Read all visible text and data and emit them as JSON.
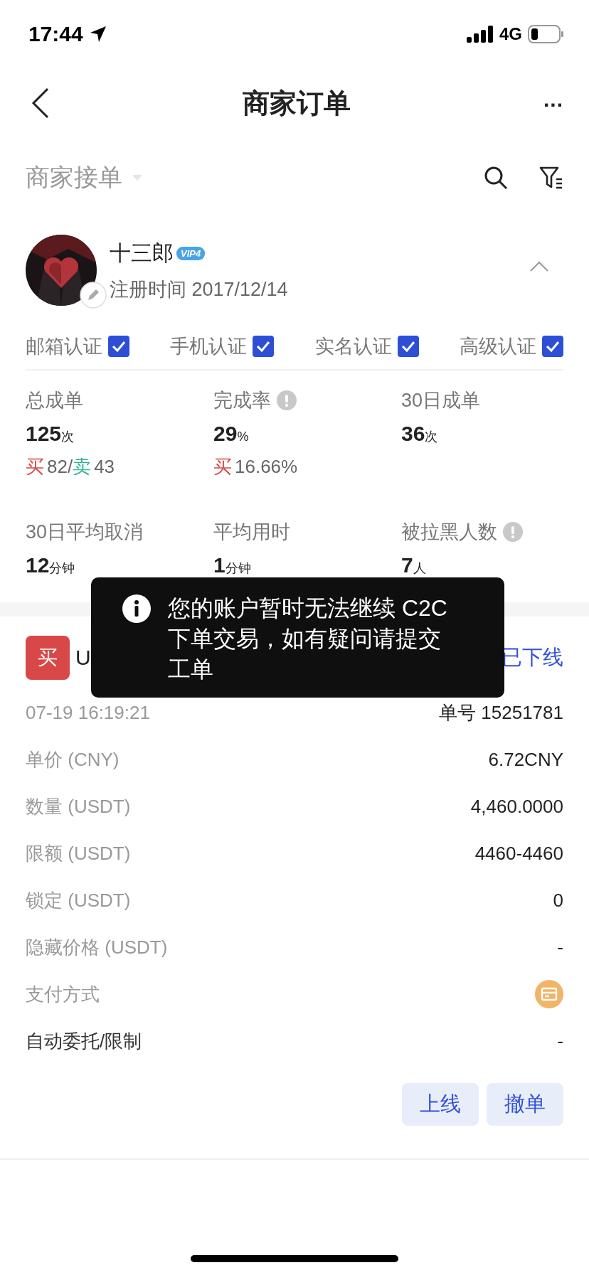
{
  "status_bar": {
    "time": "17:44",
    "network": "4G"
  },
  "nav": {
    "title": "商家订单",
    "more": "..."
  },
  "filter": {
    "label": "商家接单"
  },
  "merchant": {
    "name": "十三郎",
    "vip": "VIP4",
    "registered": "注册时间 2017/12/14",
    "expanded": true,
    "verifications": [
      {
        "label": "邮箱认证",
        "checked": true
      },
      {
        "label": "手机认证",
        "checked": true
      },
      {
        "label": "实名认证",
        "checked": true
      },
      {
        "label": "高级认证",
        "checked": true
      }
    ]
  },
  "stats": [
    {
      "label": "总成单",
      "info": false,
      "value": "125",
      "unit": "次",
      "breakdown": [
        {
          "kind": "buy",
          "text": "买"
        },
        {
          "kind": "plain",
          "text": "82/"
        },
        {
          "kind": "sell",
          "text": "卖"
        },
        {
          "kind": "plain",
          "text": "43"
        }
      ]
    },
    {
      "label": "完成率",
      "info": true,
      "value": "29",
      "unit": "%",
      "breakdown": [
        {
          "kind": "buy",
          "text": "买"
        },
        {
          "kind": "plain",
          "text": "16.66%"
        }
      ]
    },
    {
      "label": "30日成单",
      "info": false,
      "value": "36",
      "unit": "次"
    },
    {
      "label": "30日平均取消",
      "info": false,
      "value": "12",
      "unit": "分钟"
    },
    {
      "label": "平均用时",
      "info": false,
      "value": "1",
      "unit": "分钟"
    },
    {
      "label": "被拉黑人数",
      "info": true,
      "value": "7",
      "unit": "人"
    }
  ],
  "order": {
    "side": "买",
    "title": "U",
    "status": "已下线",
    "date": "07-19 16:19:21",
    "number": "单号 15251781",
    "fields": [
      {
        "kind": "plain",
        "label": "单价 (CNY)",
        "value": "6.72CNY"
      },
      {
        "kind": "plain",
        "label": "数量 (USDT)",
        "value": "4,460.0000"
      },
      {
        "kind": "plain",
        "label": "限额 (USDT)",
        "value": "4460-4460"
      },
      {
        "kind": "plain",
        "label": "锁定 (USDT)",
        "value": "0"
      },
      {
        "kind": "plain",
        "label": "隐藏价格 (USDT)",
        "value": "-"
      },
      {
        "kind": "payment",
        "label": "支付方式"
      },
      {
        "kind": "strong",
        "label": "自动委托/限制",
        "value": "-"
      }
    ],
    "buttons": [
      "上线",
      "撤单"
    ]
  },
  "toast": {
    "message": "您的账户暂时无法继续 C2C 下单交易，如有疑问请提交工单"
  }
}
